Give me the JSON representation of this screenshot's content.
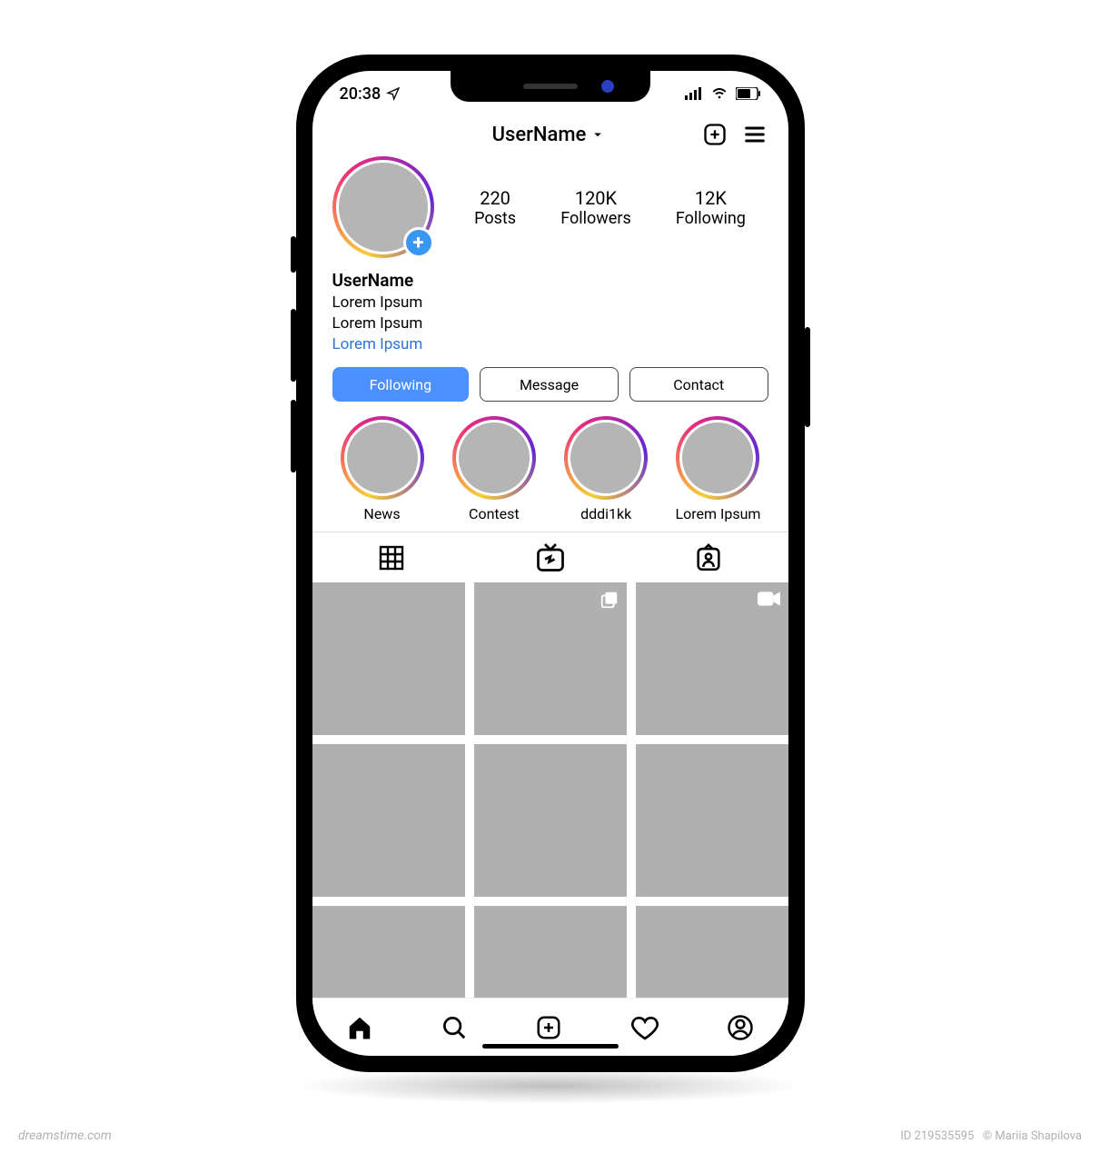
{
  "status": {
    "time": "20:38"
  },
  "header": {
    "username": "UserName"
  },
  "stats": {
    "posts": {
      "count": "220",
      "label": "Posts"
    },
    "followers": {
      "count": "120K",
      "label": "Followers"
    },
    "following": {
      "count": "12K",
      "label": "Following"
    }
  },
  "bio": {
    "username": "UserName",
    "line1": "Lorem Ipsum",
    "line2": "Lorem Ipsum",
    "link": "Lorem Ipsum"
  },
  "buttons": {
    "following": "Following",
    "message": "Message",
    "contact": "Contact"
  },
  "highlights": [
    {
      "label": "News"
    },
    {
      "label": "Contest"
    },
    {
      "label": "dddi1kk"
    },
    {
      "label": "Lorem Ipsum"
    }
  ],
  "watermark": {
    "left": "dreamstime.com",
    "id": "ID 219535595",
    "author": "© Mariia Shapilova"
  }
}
